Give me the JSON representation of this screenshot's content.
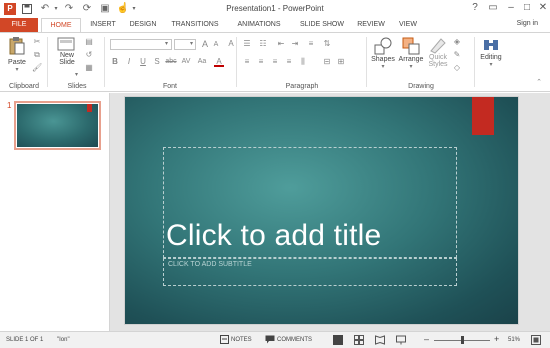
{
  "window": {
    "title": "Presentation1 - PowerPoint",
    "logo_letter": "P",
    "help": "?",
    "minimize": "–",
    "maximize": "□",
    "close": "✕",
    "signin": "Sign in"
  },
  "tabs": [
    {
      "label": "FILE"
    },
    {
      "label": "HOME"
    },
    {
      "label": "INSERT"
    },
    {
      "label": "DESIGN"
    },
    {
      "label": "TRANSITIONS"
    },
    {
      "label": "ANIMATIONS"
    },
    {
      "label": "SLIDE SHOW"
    },
    {
      "label": "REVIEW"
    },
    {
      "label": "VIEW"
    }
  ],
  "active_tab": "HOME",
  "ribbon": {
    "clipboard": {
      "label": "Clipboard",
      "paste": "Paste"
    },
    "slides": {
      "label": "Slides",
      "new_slide_line1": "New",
      "new_slide_line2": "Slide"
    },
    "font": {
      "label": "Font",
      "grow": "A",
      "shrink": "A",
      "bold": "B",
      "italic": "I",
      "underline": "U",
      "strike": "S",
      "abc": "abc",
      "spacing": "AV",
      "case": "Aa",
      "color": "A",
      "clear": "A"
    },
    "paragraph": {
      "label": "Paragraph"
    },
    "drawing": {
      "label": "Drawing",
      "shapes": "Shapes",
      "arrange": "Arrange",
      "quick_styles_line1": "Quick",
      "quick_styles_line2": "Styles"
    },
    "editing": {
      "label": "Editing"
    }
  },
  "thumbnails": [
    {
      "number": "1"
    }
  ],
  "slide": {
    "title_placeholder": "Click to add title",
    "subtitle_placeholder": "CLICK TO ADD SUBTITLE"
  },
  "status": {
    "slide_info": "SLIDE 1 OF 1",
    "theme": "\"Ion\"",
    "notes": "NOTES",
    "comments": "COMMENTS",
    "zoom_minus": "–",
    "zoom_plus": "+",
    "zoom": "51%",
    "zoom_level": 0.51
  },
  "colors": {
    "accent": "#d24726",
    "slide_bg": "#327577",
    "slide_accent": "#c32a21"
  }
}
